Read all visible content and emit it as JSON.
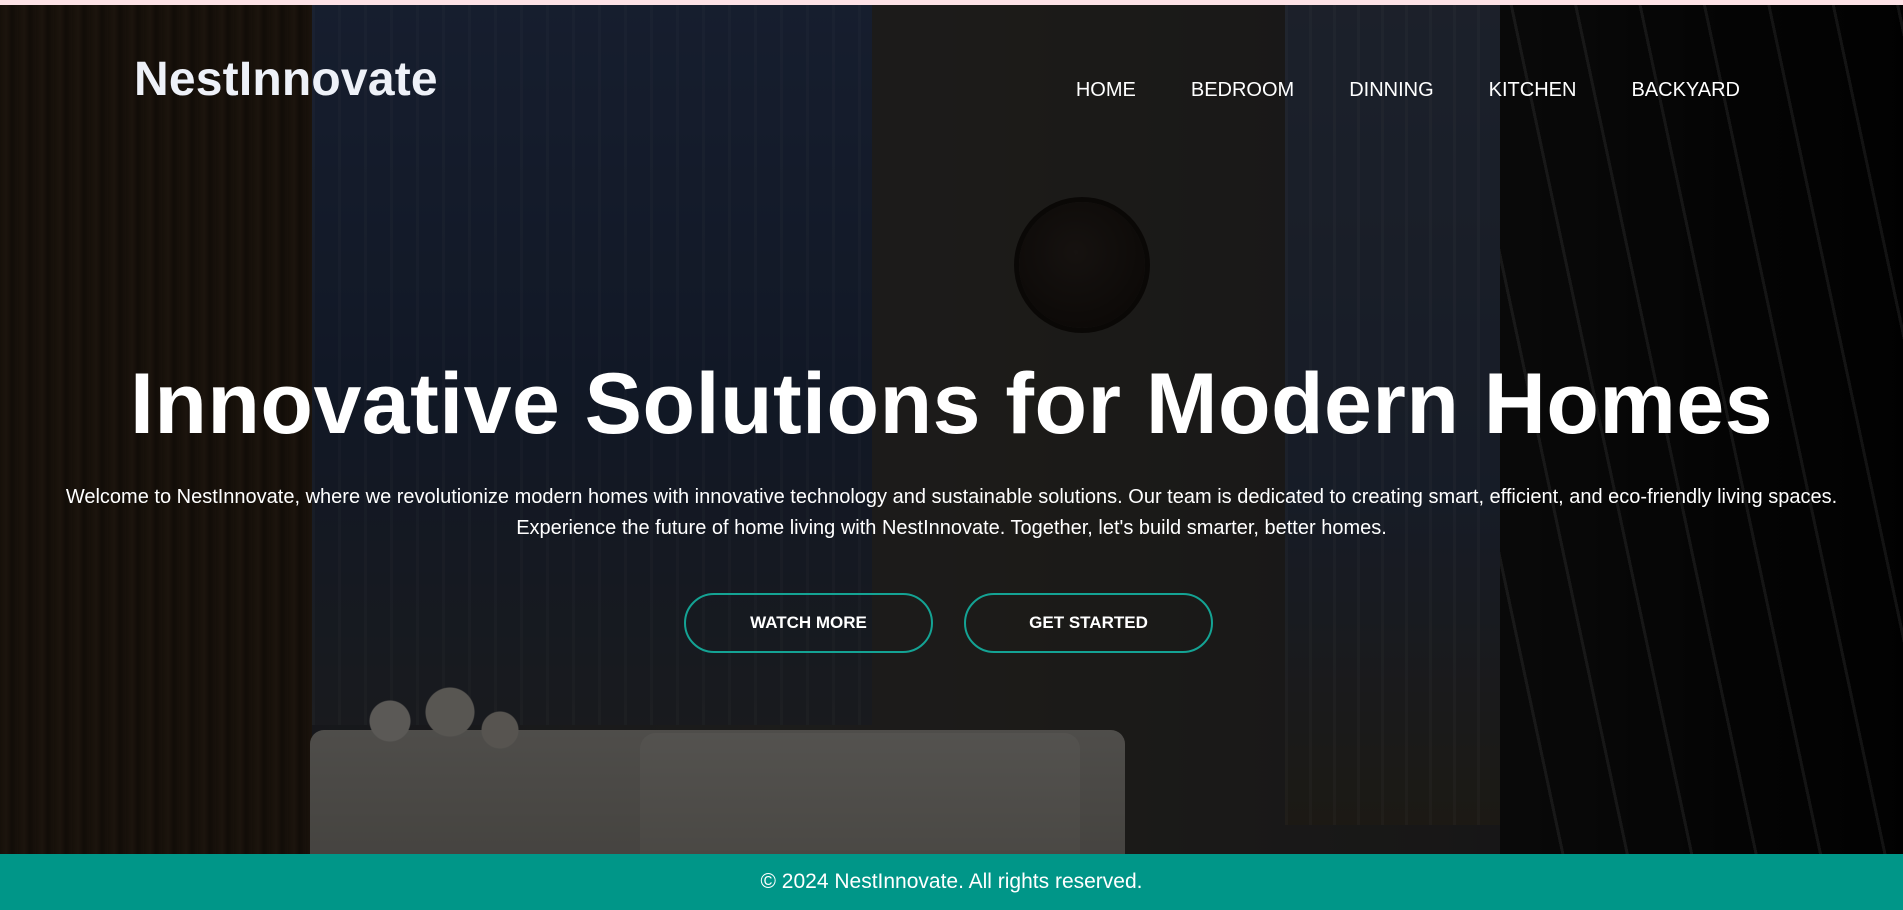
{
  "brand": {
    "name": "NestInnovate"
  },
  "nav": {
    "items": [
      {
        "label": "HOME"
      },
      {
        "label": "BEDROOM"
      },
      {
        "label": "DINNING"
      },
      {
        "label": "KITCHEN"
      },
      {
        "label": "BACKYARD"
      }
    ]
  },
  "hero": {
    "headline": "Innovative Solutions for Modern Homes",
    "intro_line_1": "Welcome to NestInnovate, where we revolutionize modern homes with innovative technology and sustainable solutions. Our team is dedicated to creating smart, efficient, and eco-friendly living spaces.",
    "intro_line_2": "Experience the future of home living with NestInnovate. Together, let's build smarter, better homes.",
    "buttons": {
      "watch_more": "WATCH MORE",
      "get_started": "GET STARTED"
    }
  },
  "footer": {
    "text": "© 2024 NestInnovate. All rights reserved."
  },
  "colors": {
    "accent": "#009688",
    "button_border": "#14a394",
    "top_strip": "#fde2e6"
  }
}
